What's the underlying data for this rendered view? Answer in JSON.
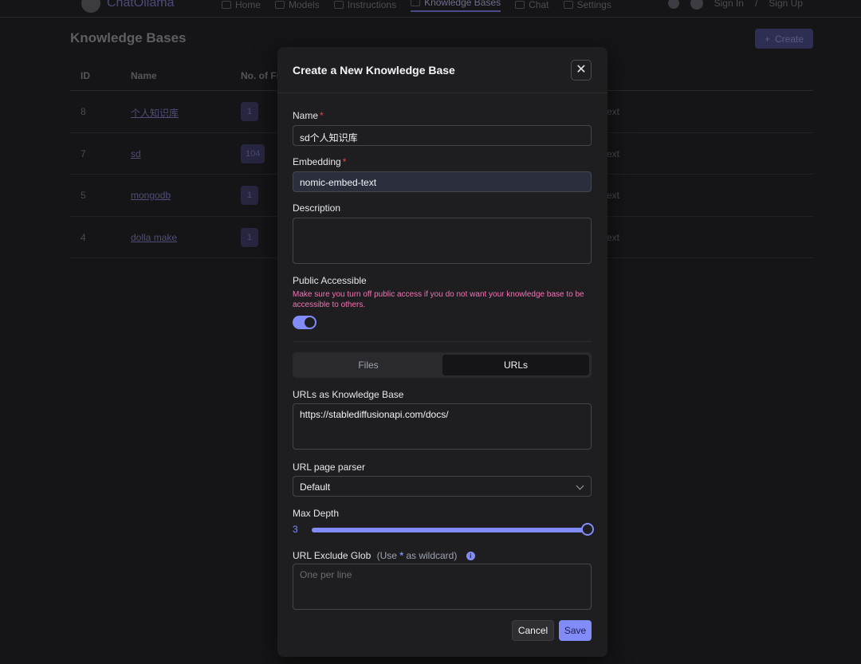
{
  "app": {
    "name": "ChatOllama"
  },
  "nav": {
    "items": [
      {
        "label": "Home",
        "icon": "home-icon"
      },
      {
        "label": "Models",
        "icon": "box-icon"
      },
      {
        "label": "Instructions",
        "icon": "terminal-icon"
      },
      {
        "label": "Knowledge Bases",
        "icon": "book-icon",
        "active": true
      },
      {
        "label": "Chat",
        "icon": "chat-icon"
      },
      {
        "label": "Settings",
        "icon": "gear-icon"
      }
    ],
    "sign_in": "Sign In",
    "separator": "/",
    "sign_up": "Sign Up"
  },
  "page": {
    "title": "Knowledge Bases",
    "create_label": "Create",
    "table": {
      "headers": {
        "id": "ID",
        "name": "Name",
        "files": "No. of Fi"
      },
      "rows": [
        {
          "id": "8",
          "name": "个人知识库",
          "files": "1",
          "embedding": "ext"
        },
        {
          "id": "7",
          "name": "sd",
          "files": "104",
          "embedding": "ext"
        },
        {
          "id": "5",
          "name": "mongodb",
          "files": "1",
          "embedding": "ext"
        },
        {
          "id": "4",
          "name": "dolla make",
          "files": "1",
          "embedding": "ext"
        }
      ]
    }
  },
  "modal": {
    "title": "Create a New Knowledge Base",
    "close_symbol": "✕",
    "name": {
      "label": "Name",
      "required": "*",
      "value": "sd个人知识库"
    },
    "embedding": {
      "label": "Embedding",
      "required": "*",
      "value": "nomic-embed-text"
    },
    "description": {
      "label": "Description",
      "value": ""
    },
    "public": {
      "label": "Public Accessible",
      "hint": "Make sure you turn off public access if you do not want your knowledge base to be accessible to others.",
      "enabled": true
    },
    "tabs": [
      {
        "label": "Files",
        "active": false
      },
      {
        "label": "URLs",
        "active": true
      }
    ],
    "urls": {
      "label": "URLs as Knowledge Base",
      "value": "https://stablediffusionapi.com/docs/"
    },
    "parser": {
      "label": "URL page parser",
      "value": "Default"
    },
    "max_depth": {
      "label": "Max Depth",
      "value": "3",
      "fill": 1.0
    },
    "exclude": {
      "label": "URL Exclude Glob",
      "sub_prefix": "(Use",
      "wildcard": "*",
      "sub_suffix": "as wildcard)",
      "info_icon": "info-icon",
      "placeholder": "One per line"
    },
    "cancel_label": "Cancel",
    "save_label": "Save"
  },
  "colors": {
    "accent": "#818cf8",
    "required": "#ef4444",
    "hint": "#f472b6"
  }
}
